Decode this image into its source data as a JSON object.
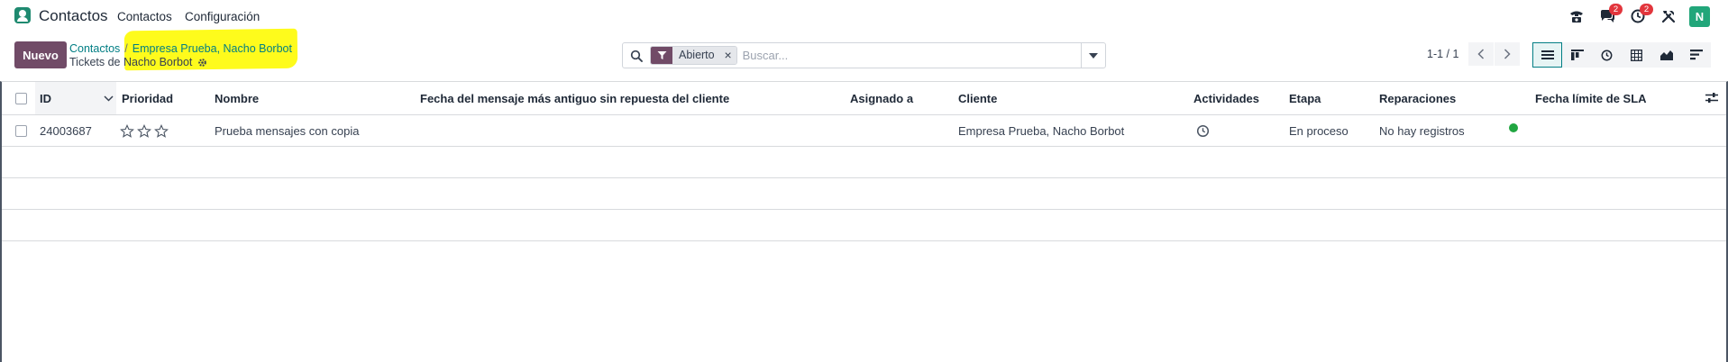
{
  "navbar": {
    "app_icon": "contacts-app-icon",
    "app_name": "Contactos",
    "menu": [
      "Contactos",
      "Configuración"
    ],
    "icons": [
      {
        "name": "phone-icon",
        "badge": ""
      },
      {
        "name": "messages-icon",
        "badge": "2"
      },
      {
        "name": "activity-clock-icon",
        "badge": "2"
      },
      {
        "name": "tools-icon",
        "badge": ""
      }
    ],
    "avatar_initial": "N"
  },
  "control_panel": {
    "new_button": "Nuevo",
    "breadcrumb": {
      "root": "Contactos",
      "separator": "/",
      "record": "Empresa Prueba, Nacho Borbot"
    },
    "view_title": "Tickets de Nacho Borbot",
    "search": {
      "facet_label": "Abierto",
      "facet_remove": "×",
      "placeholder": "Buscar..."
    },
    "pager": "1-1 / 1",
    "views": [
      "list-view-icon",
      "kanban-view-icon",
      "activity-view-icon",
      "pivot-view-icon",
      "graph-view-icon",
      "cohort-view-icon"
    ],
    "active_view": "list-view-icon"
  },
  "table": {
    "headers": {
      "id": "ID",
      "priority": "Prioridad",
      "name": "Nombre",
      "oldest_message": "Fecha del mensaje más antiguo sin repuesta del cliente",
      "assigned": "Asignado a",
      "customer": "Cliente",
      "activities": "Actividades",
      "stage": "Etapa",
      "repairs": "Reparaciones",
      "sla_deadline": "Fecha límite de SLA"
    },
    "rows": [
      {
        "id": "24003687",
        "priority_stars": 0,
        "name": "Prueba mensajes con copia",
        "oldest_message": "",
        "assigned": "",
        "customer": "Empresa Prueba, Nacho Borbot",
        "activities_icon": "clock-icon",
        "stage": "En proceso",
        "repairs": "No hay registros",
        "status_color": "#21a641",
        "sla_deadline": ""
      }
    ]
  },
  "colors": {
    "primary": "#714b67",
    "link": "#017e84",
    "highlight": "#fefb1c",
    "badge": "#e2353c"
  }
}
